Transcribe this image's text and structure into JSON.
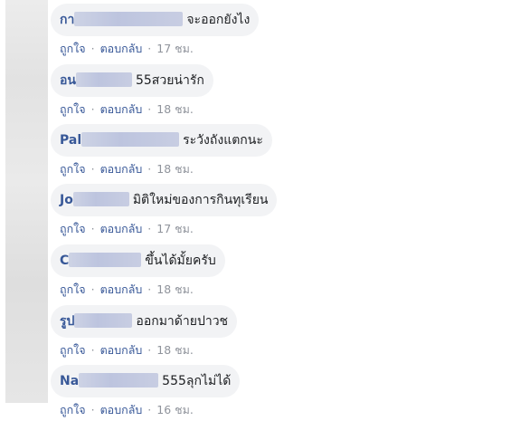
{
  "comments": [
    {
      "author_visible": "กา",
      "text": "จะออกยังไง",
      "like": "ถูกใจ",
      "reply": "ตอบกลับ",
      "time": "17 ชม."
    },
    {
      "author_visible": "อน",
      "text": "55สวยน่ารัก",
      "like": "ถูกใจ",
      "reply": "ตอบกลับ",
      "time": "18 ชม."
    },
    {
      "author_visible": "Pal",
      "text": "ระวังถังแตกนะ",
      "like": "ถูกใจ",
      "reply": "ตอบกลับ",
      "time": "18 ชม."
    },
    {
      "author_visible": "Jo",
      "text": "มิติใหม่ของการกินทุเรียน",
      "like": "ถูกใจ",
      "reply": "ตอบกลับ",
      "time": "17 ชม."
    },
    {
      "author_visible": "C",
      "text": "ขึ้นได้มั้ยครับ",
      "like": "ถูกใจ",
      "reply": "ตอบกลับ",
      "time": "18 ชม."
    },
    {
      "author_visible": "รูป",
      "text": "ออกมาด้ายปาวช",
      "like": "ถูกใจ",
      "reply": "ตอบกลับ",
      "time": "18 ชม."
    },
    {
      "author_visible": "Na",
      "text": "555ลุกไม่ได้",
      "like": "ถูกใจ",
      "reply": "ตอบกลับ",
      "time": "16 ชม."
    }
  ],
  "separator": "·",
  "colors": {
    "bubble_bg": "#f2f3f5",
    "author": "#385898",
    "meta": "#90949c"
  }
}
